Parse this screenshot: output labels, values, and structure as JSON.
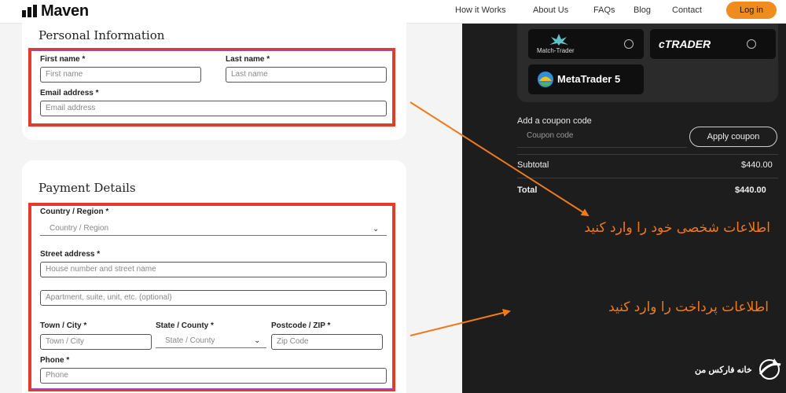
{
  "header": {
    "logo": "Maven",
    "nav": [
      "How it Works",
      "About Us",
      "FAQs",
      "Blog",
      "Contact"
    ],
    "login": "Log in"
  },
  "personal": {
    "title": "Personal Information",
    "first_name_label": "First name *",
    "first_name_placeholder": "First name",
    "last_name_label": "Last name *",
    "last_name_placeholder": "Last name",
    "email_label": "Email address *",
    "email_placeholder": "Email address"
  },
  "payment": {
    "title": "Payment Details",
    "country_label": "Country / Region *",
    "country_placeholder": "Country / Region",
    "street_label": "Street address *",
    "street_placeholder": "House number and street name",
    "apartment_placeholder": "Apartment, suite, unit, etc. (optional)",
    "town_label": "Town / City *",
    "town_placeholder": "Town / City",
    "state_label": "State / County *",
    "state_placeholder": "State / County",
    "postcode_label": "Postcode / ZIP *",
    "postcode_placeholder": "Zip Code",
    "phone_label": "Phone *",
    "phone_placeholder": "Phone"
  },
  "platforms": {
    "match_trader": "Match-Trader",
    "ctrader": "cTRADER",
    "metatrader": "MetaTrader 5"
  },
  "order": {
    "coupon_label": "Add a coupon code",
    "coupon_placeholder": "Coupon code",
    "apply": "Apply coupon",
    "subtotal_label": "Subtotal",
    "subtotal_value": "$440.00",
    "total_label": "Total",
    "total_value": "$440.00"
  },
  "annotations": {
    "personal": "اطلاعات شخصی خود را وارد کنید",
    "payment": "اطلاعات پرداخت را وارد کنید"
  },
  "watermark": "خانه فارکس من",
  "colors": {
    "accent_orange": "#f08c1e",
    "highlight_red": "#e23b2a",
    "annotation_orange": "#f07a1a",
    "dark_panel": "#1d1d1d"
  }
}
